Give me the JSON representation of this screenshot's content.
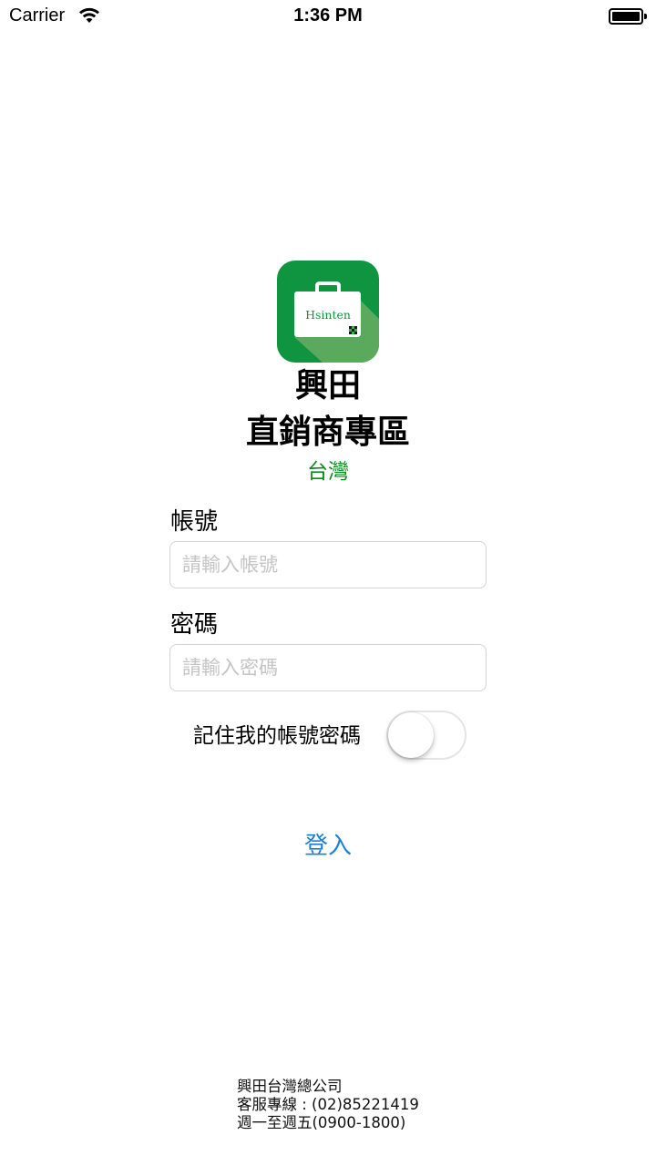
{
  "status_bar": {
    "carrier": "Carrier",
    "time": "1:36 PM",
    "wifi_icon": "wifi-icon",
    "battery_icon": "battery-icon"
  },
  "logo": {
    "icon": "briefcase-logo-icon",
    "text": "Hsinten",
    "bg_color": "#0f9440"
  },
  "header": {
    "brand": "興田",
    "title": "直銷商專區",
    "region": "台灣"
  },
  "form": {
    "account_label": "帳號",
    "account_placeholder": "請輸入帳號",
    "account_value": "",
    "password_label": "密碼",
    "password_placeholder": "請輸入密碼",
    "password_value": "",
    "remember_label": "記住我的帳號密碼",
    "remember_on": false,
    "login_label": "登入"
  },
  "footer": {
    "company": "興田台灣總公司",
    "hotline": "客服專線 : (02)85221419",
    "hours": "週一至週五(0900-1800)"
  },
  "colors": {
    "accent_green": "#0d8a1e",
    "link_blue": "#1a7fd6"
  }
}
